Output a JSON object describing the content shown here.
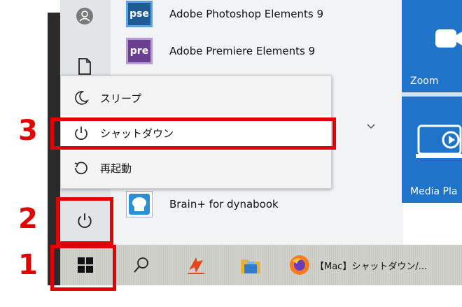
{
  "apps": [
    {
      "label": "Adobe Photoshop Elements 9",
      "icon_text": "pse",
      "icon_color": "#2a6fb0"
    },
    {
      "label": "Adobe Premiere Elements 9",
      "icon_text": "pre",
      "icon_color": "#7b4fa0"
    },
    {
      "label": "Brain+ for dynabook",
      "icon_text": "",
      "icon_color": "#3a9ad9"
    }
  ],
  "tiles": [
    {
      "label": "Zoom"
    },
    {
      "label": "Media Pla"
    }
  ],
  "power_menu": {
    "sleep_label": "スリープ",
    "shutdown_label": "シャットダウン",
    "restart_label": "再起動"
  },
  "taskbar": {
    "browser_tab_label": "【Mac】シャットダウン/..."
  },
  "annotations": {
    "step1": "1",
    "step2": "2",
    "step3": "3"
  },
  "colors": {
    "annotation_red": "#e30000",
    "tile_blue": "#1f74c9"
  }
}
